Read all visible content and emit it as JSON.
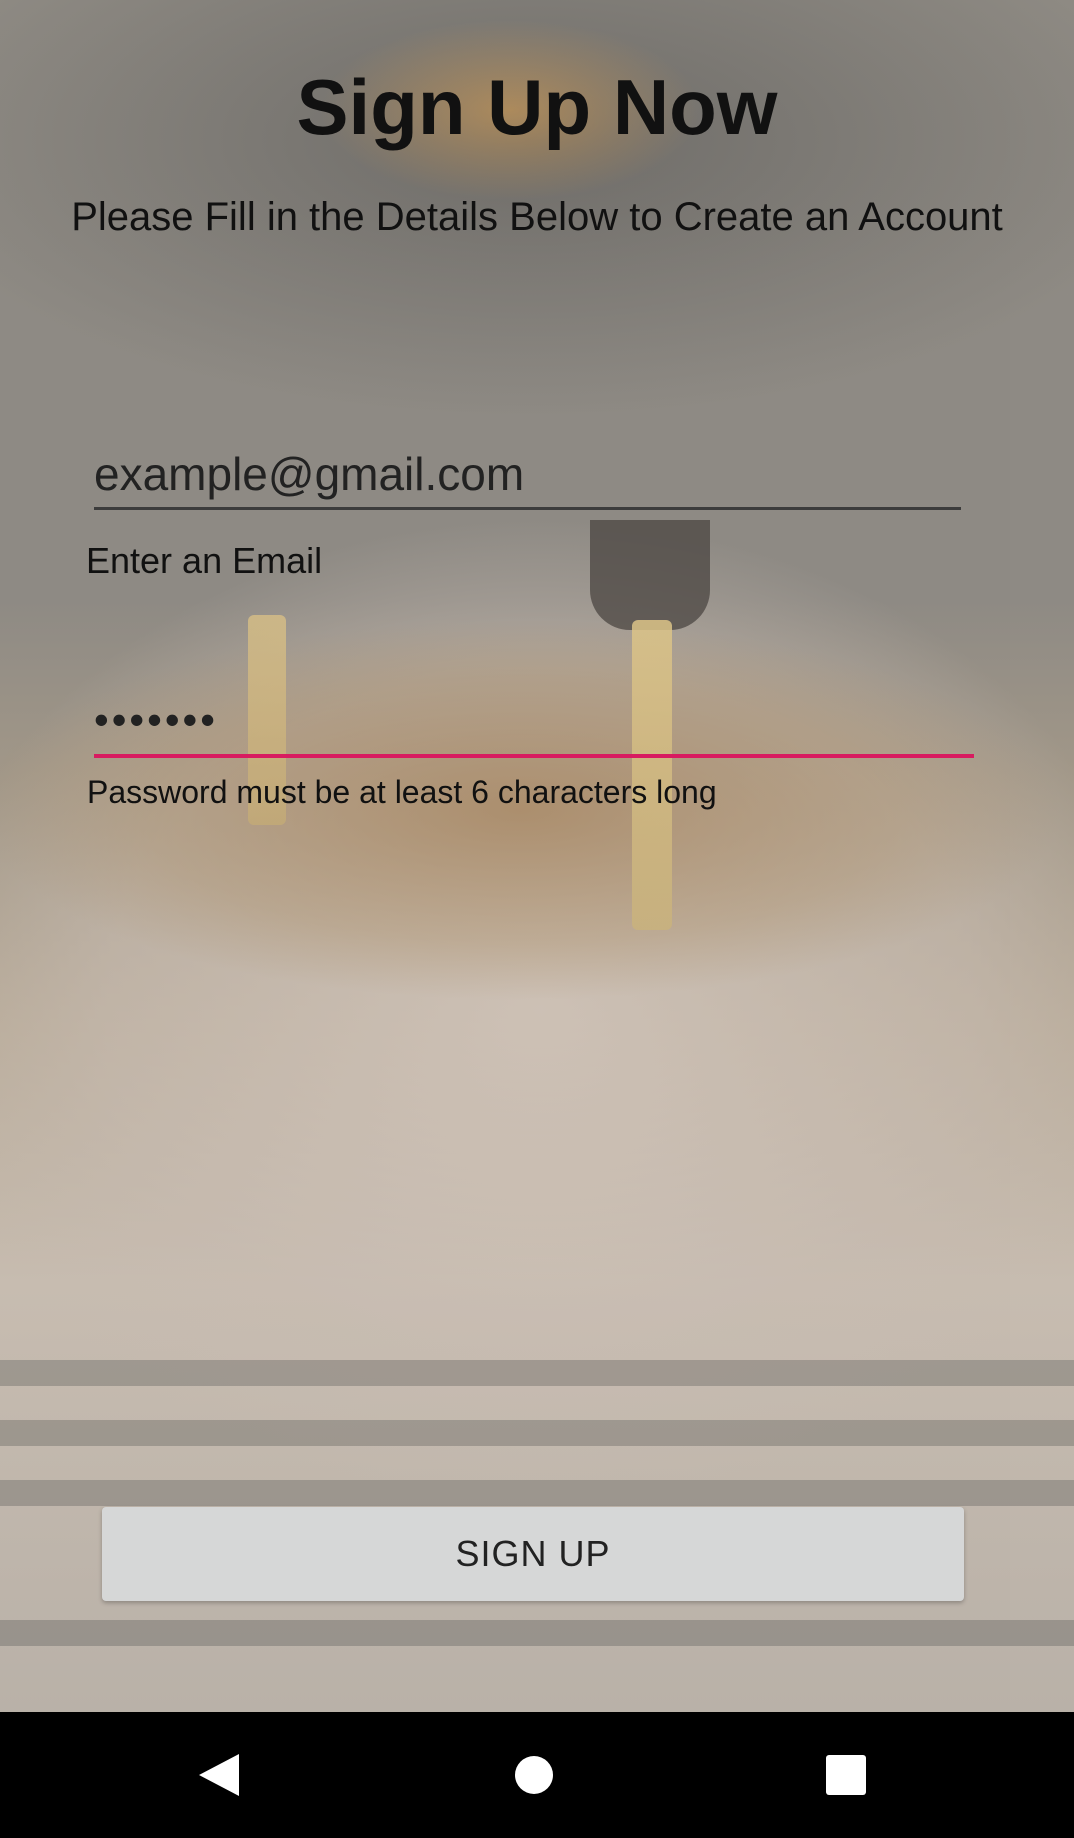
{
  "screen": {
    "title": "Sign Up Now",
    "subtitle": "Please Fill in the Details Below to Create an Account"
  },
  "form": {
    "email": {
      "value": "example@gmail.com",
      "helper": "Enter an Email"
    },
    "password": {
      "value": "•••••••",
      "helper": "Password must be at least 6 characters long",
      "accent_color": "#d81b60"
    },
    "submit_label": "SIGN UP"
  },
  "navbar": {
    "back_icon": "back-triangle-icon",
    "home_icon": "home-circle-icon",
    "recents_icon": "recents-square-icon"
  }
}
